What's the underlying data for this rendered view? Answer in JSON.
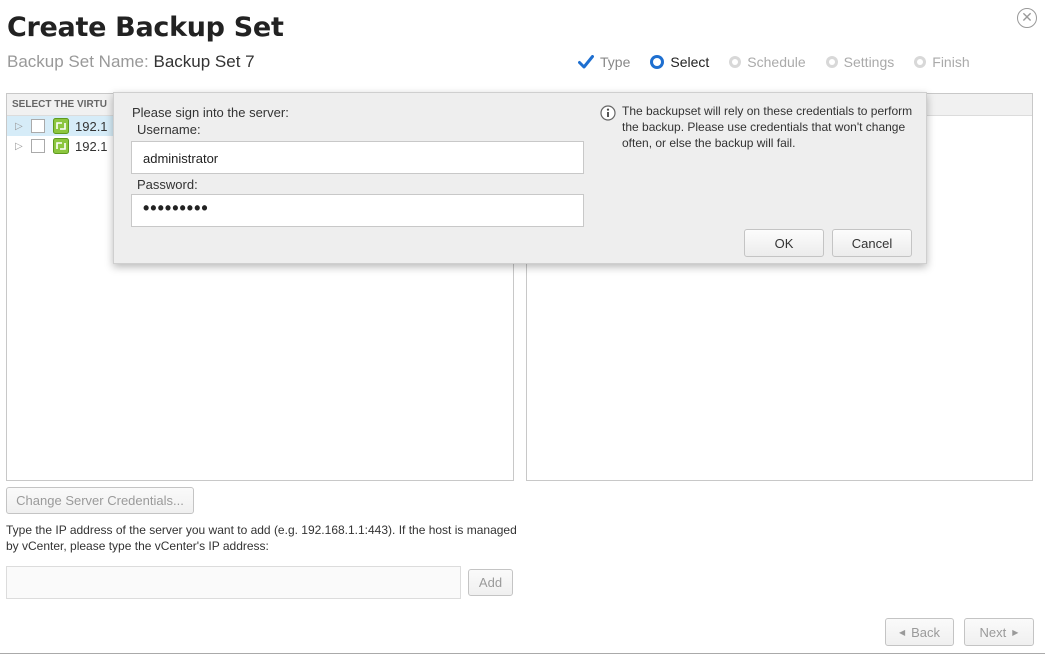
{
  "header": {
    "title": "Create Backup Set",
    "set_name_label": "Backup Set Name:",
    "set_name_value": "Backup Set 7"
  },
  "steps": [
    {
      "label": "Type",
      "state": "done"
    },
    {
      "label": "Select",
      "state": "current"
    },
    {
      "label": "Schedule",
      "state": "pending"
    },
    {
      "label": "Settings",
      "state": "pending"
    },
    {
      "label": "Finish",
      "state": "pending"
    }
  ],
  "left_panel": {
    "header": "SELECT THE VIRTU",
    "items": [
      {
        "label": "192.1"
      },
      {
        "label": "192.1"
      }
    ]
  },
  "actions": {
    "change_credentials": "Change Server Credentials...",
    "help_text": "Type the IP address of the server you want to add (e.g. 192.168.1.1:443). If the host is managed by vCenter, please type the vCenter's IP address:",
    "add": "Add",
    "back": "Back",
    "next": "Next"
  },
  "dialog": {
    "prompt": "Please sign into the server:",
    "username_label": "Username:",
    "username_value": "administrator",
    "password_label": "Password:",
    "password_value": "•••••••••",
    "info": "The backupset will rely on these credentials to perform the backup. Please use credentials that won't change often, or else the backup will fail.",
    "ok": "OK",
    "cancel": "Cancel"
  },
  "colors": {
    "accent": "#1e6fd0",
    "selection": "#d6ecf8",
    "host_icon": "#8cc63f"
  }
}
